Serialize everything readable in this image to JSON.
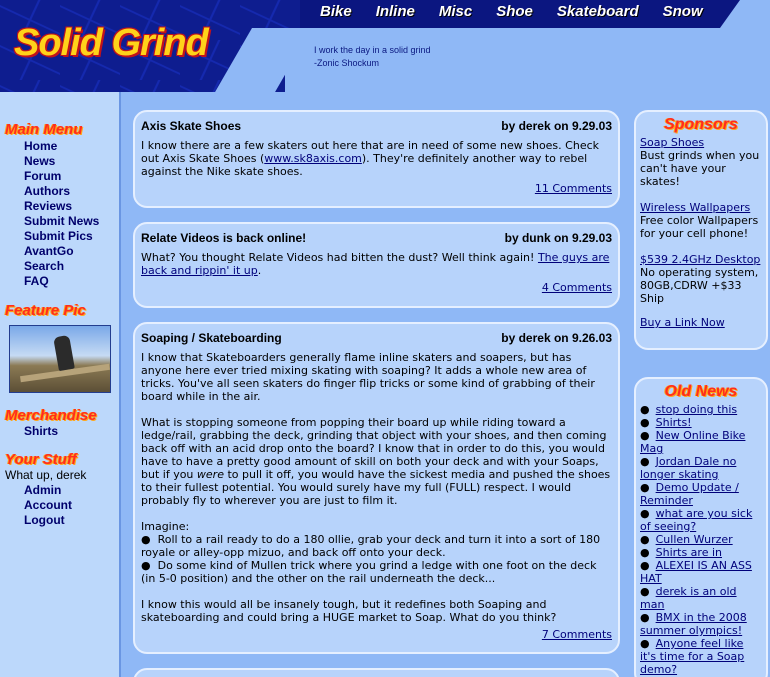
{
  "header": {
    "logo": "Solid Grind",
    "nav": [
      "Bike",
      "Inline",
      "Misc",
      "Shoe",
      "Skateboard",
      "Snow"
    ],
    "quote_line1": "I work the day in a solid grind",
    "quote_line2": "-Zonic Shockum"
  },
  "left": {
    "main_menu_title": "Main Menu",
    "menu": [
      "Home",
      "News",
      "Forum",
      "Authors",
      "Reviews",
      "Submit News",
      "Submit Pics",
      "AvantGo",
      "Search",
      "FAQ"
    ],
    "feature_title": "Feature  Pic",
    "merch_title": "Merchandise",
    "merch_items": [
      "Shirts"
    ],
    "your_stuff_title": "Your Stuff",
    "greeting": "What up, derek",
    "user_links": [
      "Admin",
      "Account",
      "Logout"
    ]
  },
  "news": [
    {
      "title": "Axis Skate Shoes",
      "byline": "by derek on 9.29.03",
      "body_pre": "I know there are a few skaters out here that are in need of some new shoes. Check out Axis Skate Shoes (",
      "link": "www.sk8axis.com",
      "body_post": "). They're definitely another way to rebel against the Nike skate shoes.",
      "comments": "11 Comments"
    },
    {
      "title": "Relate Videos is back online!",
      "byline": "by dunk on 9.29.03",
      "body_pre": "What? You thought Relate Videos had bitten the dust? Well think again! ",
      "link": "The guys are back and rippin' it up",
      "body_post": ".",
      "comments": "4 Comments"
    },
    {
      "title": "Soaping / Skateboarding",
      "byline": "by derek on 9.26.03",
      "p1": "I know that Skateboarders generally flame inline skaters and soapers, but has anyone here ever tried mixing skating with soaping? It adds a whole new area of tricks. You've all seen skaters do finger flip tricks or some kind of grabbing of their board while in the air.",
      "p2a": "What is stopping someone from popping their board up while riding toward a ledge/rail, grabbing the deck, grinding that object with your shoes, and then coming back off with an acid drop onto the board? I know that in order to do this, you would have to have a pretty good amount of skill on both your deck and with your Soaps, but if you ",
      "p2em": "were",
      "p2b": " to pull it off, you would have the sickest media and pushed the shoes to their fullest potential. You would surely have my full (FULL) respect. I would probably fly to wherever you are just to film it.",
      "imagine": "Imagine:",
      "bullet1": "Roll to a rail ready to do a 180 ollie, grab your deck and turn it into a sort of 180 royale or alley-opp mizuo, and back off onto your deck.",
      "bullet2": "Do some kind of Mullen trick where you grind a ledge with one foot on the deck (in 5-0 position) and the other on the rail underneath the deck...",
      "p3": "I know this would all be insanely tough, but it redefines both Soaping and skateboarding and could bring a HUGE market to Soap. What do you think?",
      "comments": "7 Comments"
    }
  ],
  "sponsors": {
    "title": "Sponsors",
    "items": [
      {
        "link": "Soap Shoes",
        "text": "Bust grinds when you can't have your skates!"
      },
      {
        "link": "Wireless Wallpapers",
        "text": "Free color Wallpapers for your cell phone!"
      },
      {
        "link": "$539 2.4GHz Desktop",
        "text": "No operating system, 80GB,CDRW +$33 Ship"
      }
    ],
    "buy_link": "Buy a Link Now"
  },
  "old_news": {
    "title": "Old News",
    "items": [
      "stop doing this",
      "Shirts!",
      "New Online Bike Mag",
      "Jordan Dale no longer skating",
      "Demo Update / Reminder",
      "what are you sick of seeing?",
      "Cullen Wurzer",
      "Shirts are in",
      "ALEXEI IS AN ASS HAT",
      "derek is an old man",
      "BMX in the 2008 summer olympics!",
      "Anyone feel like it's time for a Soap demo?"
    ]
  }
}
